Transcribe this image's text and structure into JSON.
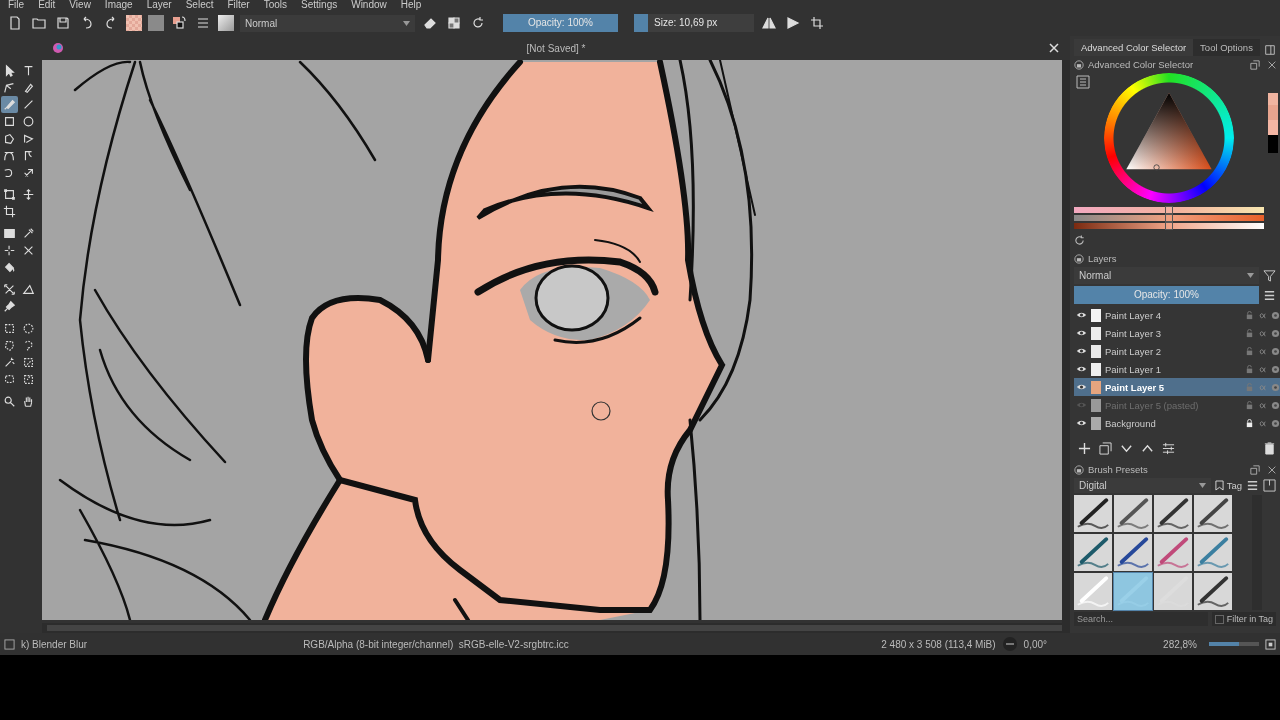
{
  "menu": [
    "File",
    "Edit",
    "View",
    "Image",
    "Layer",
    "Select",
    "Filter",
    "Tools",
    "Settings",
    "Window",
    "Help"
  ],
  "toolbar": {
    "blend_mode": "Normal",
    "opacity": {
      "label": "Opacity: 100%",
      "level": 1
    },
    "size": {
      "label": "Size: 10,69 px",
      "level": 0.12
    }
  },
  "document": {
    "title": "[Not Saved] *"
  },
  "tools": [
    {
      "selected": false
    },
    {
      "selected": false
    },
    {
      "selected": false
    },
    {
      "selected": false
    },
    {
      "selected": true
    },
    {
      "selected": false
    },
    {
      "selected": false
    },
    {
      "selected": false
    },
    {
      "selected": false
    },
    {
      "selected": false
    },
    {
      "selected": false
    },
    {
      "selected": false
    },
    {
      "selected": false
    },
    {
      "selected": false
    },
    {
      "selected": false
    },
    {
      "selected": false
    },
    {
      "selected": false
    },
    {
      "selected": false
    },
    {
      "selected": false
    },
    {
      "selected": false
    },
    {
      "selected": false
    },
    {
      "selected": false
    },
    {
      "selected": false
    },
    {
      "selected": false
    },
    {
      "selected": false
    },
    {
      "selected": false
    },
    {
      "selected": false
    },
    {
      "selected": false
    },
    {
      "selected": false
    },
    {
      "selected": false
    },
    {
      "selected": false
    },
    {
      "selected": false
    },
    {
      "selected": false
    },
    {
      "selected": false
    },
    {
      "selected": false
    }
  ],
  "dock_tabs": [
    {
      "label": "Advanced Color Selector",
      "selected": true
    },
    {
      "label": "Tool Options",
      "selected": false
    }
  ],
  "color_selector": {
    "title": "Advanced Color Selector"
  },
  "color_sliders": [
    {
      "level": 0.5
    },
    {
      "level": 0.5
    },
    {
      "level": 0.5
    }
  ],
  "layers": {
    "title": "Layers",
    "blend_mode": "Normal",
    "opacity": {
      "label": "Opacity:  100%",
      "level": 1
    },
    "items": [
      {
        "name": "Paint Layer 4",
        "visible": true,
        "selected": false,
        "locked": false
      },
      {
        "name": "Paint Layer 3",
        "visible": true,
        "selected": false,
        "locked": false
      },
      {
        "name": "Paint Layer 2",
        "visible": true,
        "selected": false,
        "locked": false
      },
      {
        "name": "Paint Layer 1",
        "visible": true,
        "selected": false,
        "locked": false
      },
      {
        "name": "Paint Layer 5",
        "visible": true,
        "selected": true,
        "locked": false
      },
      {
        "name": "Paint Layer 5 (pasted)",
        "visible": false,
        "selected": false,
        "locked": false
      },
      {
        "name": "Background",
        "visible": true,
        "selected": false,
        "locked": true
      }
    ]
  },
  "brush_presets": {
    "title": "Brush Presets",
    "tag": "Digital",
    "tag_button": "Tag",
    "presets": [
      {
        "selected": false
      },
      {
        "selected": false
      },
      {
        "selected": false
      },
      {
        "selected": false
      },
      {
        "selected": false
      },
      {
        "selected": false
      },
      {
        "selected": false
      },
      {
        "selected": false
      },
      {
        "selected": false
      },
      {
        "selected": true
      },
      {
        "selected": false
      },
      {
        "selected": false
      }
    ],
    "search_placeholder": "Search...",
    "filter_label": "Filter in Tag",
    "filter_checked": false
  },
  "status_bar": {
    "brush": "k) Blender Blur",
    "color_space": "RGB/Alpha (8-bit integer/channel)  sRGB-elle-V2-srgbtrc.icc",
    "image_size": "2 480 x 3 508 (113,4 MiB)",
    "rotation": "0,00°",
    "zoom": "282,8%",
    "zoom_slider": {
      "level": 0.6
    }
  }
}
